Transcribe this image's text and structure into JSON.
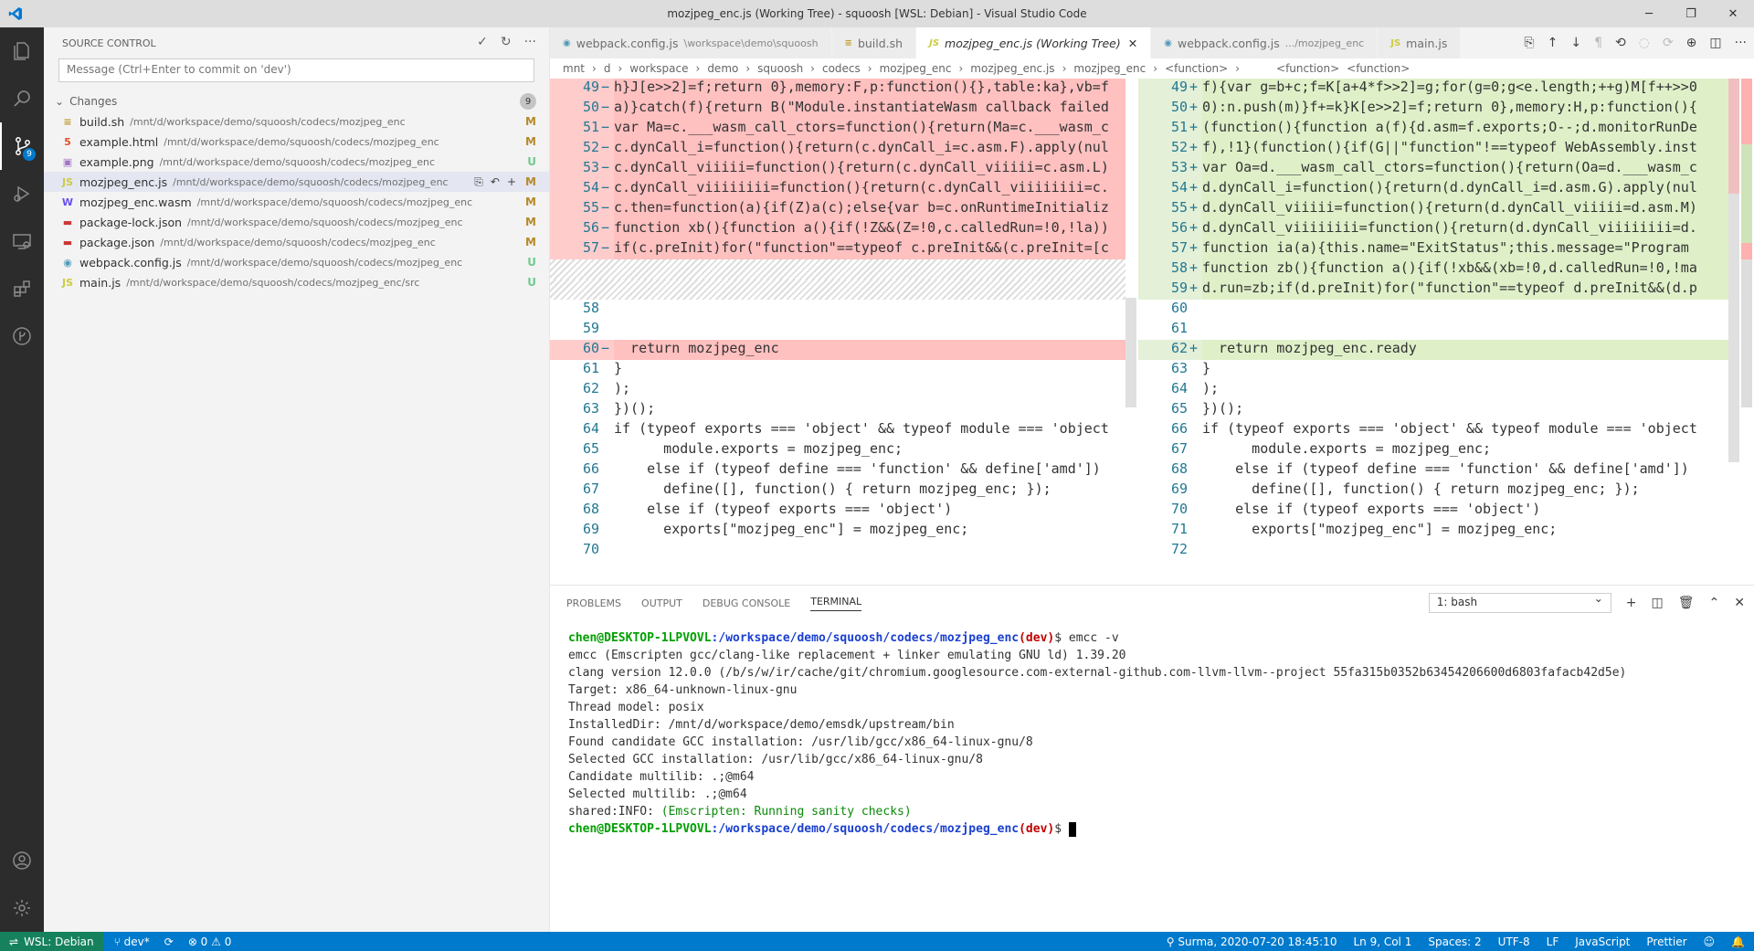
{
  "window": {
    "title": "mozjpeg_enc.js (Working Tree) - squoosh [WSL: Debian] - Visual Studio Code",
    "minimize": "─",
    "maximize": "❐",
    "close": "✕"
  },
  "sidebar": {
    "title": "SOURCE CONTROL",
    "commit_placeholder": "Message (Ctrl+Enter to commit on 'dev')",
    "changes_label": "Changes",
    "changes_count": "9",
    "files": [
      {
        "name": "build.sh",
        "path": "/mnt/d/workspace/demo/squoosh/codecs/mozjpeg_enc",
        "status": "M",
        "icon": "≡",
        "color": "#c09a2a"
      },
      {
        "name": "example.html",
        "path": "/mnt/d/workspace/demo/squoosh/codecs/mozjpeg_enc",
        "status": "M",
        "icon": "5",
        "color": "#e44d26"
      },
      {
        "name": "example.png",
        "path": "/mnt/d/workspace/demo/squoosh/codecs/mozjpeg_enc",
        "status": "U",
        "icon": "▣",
        "color": "#a074c4"
      },
      {
        "name": "mozjpeg_enc.js",
        "path": "/mnt/d/workspace/demo/squoosh/codecs/mozjpeg_enc",
        "status": "M",
        "icon": "JS",
        "color": "#cbcb41"
      },
      {
        "name": "mozjpeg_enc.wasm",
        "path": "/mnt/d/workspace/demo/squoosh/codecs/mozjpeg_enc",
        "status": "M",
        "icon": "W",
        "color": "#654ff0"
      },
      {
        "name": "package-lock.json",
        "path": "/mnt/d/workspace/demo/squoosh/codecs/mozjpeg_enc",
        "status": "M",
        "icon": "▬",
        "color": "#cb3837"
      },
      {
        "name": "package.json",
        "path": "/mnt/d/workspace/demo/squoosh/codecs/mozjpeg_enc",
        "status": "M",
        "icon": "▬",
        "color": "#cb3837"
      },
      {
        "name": "webpack.config.js",
        "path": "/mnt/d/workspace/demo/squoosh/codecs/mozjpeg_enc",
        "status": "U",
        "icon": "◉",
        "color": "#519aba"
      },
      {
        "name": "main.js",
        "path": "/mnt/d/workspace/demo/squoosh/codecs/mozjpeg_enc/src",
        "status": "U",
        "icon": "JS",
        "color": "#cbcb41"
      }
    ]
  },
  "tabs": [
    {
      "label": "webpack.config.js",
      "sub": "\\workspace\\demo\\squoosh",
      "icon": "◉"
    },
    {
      "label": "build.sh",
      "sub": "",
      "icon": "≡"
    },
    {
      "label": "mozjpeg_enc.js (Working Tree)",
      "sub": "",
      "icon": "JS"
    },
    {
      "label": "webpack.config.js",
      "sub": ".../mozjpeg_enc",
      "icon": "◉"
    },
    {
      "label": "main.js",
      "sub": "",
      "icon": "JS"
    }
  ],
  "breadcrumbs": [
    "mnt",
    "d",
    "workspace",
    "demo",
    "squoosh",
    "codecs",
    "mozjpeg_enc",
    "mozjpeg_enc.js",
    "mozjpeg_enc",
    "<function>"
  ],
  "breadcrumbs_right": [
    "<function>",
    "<function>"
  ],
  "diff": {
    "left": [
      {
        "n": "49",
        "t": "del",
        "code": "h}J[e>>2]=f;return 0},memory:F,p:function(){},table:ka},vb=f"
      },
      {
        "n": "50",
        "t": "del",
        "code": "a)}catch(f){return B(\"Module.instantiateWasm callback failed"
      },
      {
        "n": "51",
        "t": "del",
        "code": "var Ma=c.___wasm_call_ctors=function(){return(Ma=c.___wasm_c"
      },
      {
        "n": "52",
        "t": "del",
        "code": "c.dynCall_i=function(){return(c.dynCall_i=c.asm.F).apply(nul"
      },
      {
        "n": "53",
        "t": "del",
        "code": "c.dynCall_viiiii=function(){return(c.dynCall_viiiii=c.asm.L)"
      },
      {
        "n": "54",
        "t": "del",
        "code": "c.dynCall_viiiiiiii=function(){return(c.dynCall_viiiiiiii=c."
      },
      {
        "n": "55",
        "t": "del",
        "code": "c.then=function(a){if(Z)a(c);else{var b=c.onRuntimeInitializ"
      },
      {
        "n": "56",
        "t": "del",
        "code": "function xb(){function a(){if(!Z&&(Z=!0,c.calledRun=!0,!la))"
      },
      {
        "n": "57",
        "t": "del",
        "code": "if(c.preInit)for(\"function\"==typeof c.preInit&&(c.preInit=[c"
      },
      {
        "n": "",
        "t": "hatch",
        "code": ""
      },
      {
        "n": "",
        "t": "hatch",
        "code": ""
      },
      {
        "n": "58",
        "t": "",
        "code": ""
      },
      {
        "n": "59",
        "t": "",
        "code": ""
      },
      {
        "n": "60",
        "t": "del",
        "code": "  return mozjpeg_enc"
      },
      {
        "n": "61",
        "t": "",
        "code": "}"
      },
      {
        "n": "62",
        "t": "",
        "code": ");"
      },
      {
        "n": "63",
        "t": "",
        "code": "})();"
      },
      {
        "n": "64",
        "t": "",
        "code": "if (typeof exports === 'object' && typeof module === 'object"
      },
      {
        "n": "65",
        "t": "",
        "code": "      module.exports = mozjpeg_enc;"
      },
      {
        "n": "66",
        "t": "",
        "code": "    else if (typeof define === 'function' && define['amd'])"
      },
      {
        "n": "67",
        "t": "",
        "code": "      define([], function() { return mozjpeg_enc; });"
      },
      {
        "n": "68",
        "t": "",
        "code": "    else if (typeof exports === 'object')"
      },
      {
        "n": "69",
        "t": "",
        "code": "      exports[\"mozjpeg_enc\"] = mozjpeg_enc;"
      },
      {
        "n": "70",
        "t": "",
        "code": ""
      }
    ],
    "right": [
      {
        "n": "49",
        "t": "ins",
        "code": "f){var g=b+c;f=K[a+4*f>>2]=g;for(g=0;g<e.length;++g)M[f++>>0"
      },
      {
        "n": "50",
        "t": "ins",
        "code": "0):n.push(m)}f+=k}K[e>>2]=f;return 0},memory:H,p:function(){"
      },
      {
        "n": "51",
        "t": "ins",
        "code": "(function(){function a(f){d.asm=f.exports;O--;d.monitorRunDe"
      },
      {
        "n": "52",
        "t": "ins",
        "code": "f),!1}(function(){if(G||\"function\"!==typeof WebAssembly.inst"
      },
      {
        "n": "53",
        "t": "ins",
        "code": "var Oa=d.___wasm_call_ctors=function(){return(Oa=d.___wasm_c"
      },
      {
        "n": "54",
        "t": "ins",
        "code": "d.dynCall_i=function(){return(d.dynCall_i=d.asm.G).apply(nul"
      },
      {
        "n": "55",
        "t": "ins",
        "code": "d.dynCall_viiiii=function(){return(d.dynCall_viiiii=d.asm.M)"
      },
      {
        "n": "56",
        "t": "ins",
        "code": "d.dynCall_viiiiiiii=function(){return(d.dynCall_viiiiiiii=d."
      },
      {
        "n": "57",
        "t": "ins",
        "code": "function ia(a){this.name=\"ExitStatus\";this.message=\"Program "
      },
      {
        "n": "58",
        "t": "ins",
        "code": "function zb(){function a(){if(!xb&&(xb=!0,d.calledRun=!0,!ma"
      },
      {
        "n": "59",
        "t": "ins",
        "code": "d.run=zb;if(d.preInit)for(\"function\"==typeof d.preInit&&(d.p"
      },
      {
        "n": "60",
        "t": "",
        "code": ""
      },
      {
        "n": "61",
        "t": "",
        "code": ""
      },
      {
        "n": "62",
        "t": "ins",
        "code": "  return mozjpeg_enc.ready"
      },
      {
        "n": "63",
        "t": "",
        "code": "}"
      },
      {
        "n": "64",
        "t": "",
        "code": ");"
      },
      {
        "n": "65",
        "t": "",
        "code": "})();"
      },
      {
        "n": "66",
        "t": "",
        "code": "if (typeof exports === 'object' && typeof module === 'object"
      },
      {
        "n": "67",
        "t": "",
        "code": "      module.exports = mozjpeg_enc;"
      },
      {
        "n": "68",
        "t": "",
        "code": "    else if (typeof define === 'function' && define['amd'])"
      },
      {
        "n": "69",
        "t": "",
        "code": "      define([], function() { return mozjpeg_enc; });"
      },
      {
        "n": "70",
        "t": "",
        "code": "    else if (typeof exports === 'object')"
      },
      {
        "n": "71",
        "t": "",
        "code": "      exports[\"mozjpeg_enc\"] = mozjpeg_enc;"
      },
      {
        "n": "72",
        "t": "",
        "code": ""
      }
    ]
  },
  "panel": {
    "tabs": [
      "PROBLEMS",
      "OUTPUT",
      "DEBUG CONSOLE",
      "TERMINAL"
    ],
    "terminal_select": "1: bash",
    "prompt_user": "chen@DESKTOP-1LPVOVL",
    "prompt_path": ":/workspace/demo/squoosh/codecs/mozjpeg_enc",
    "prompt_branch": "(dev)",
    "command": "$ emcc -v",
    "output": [
      "emcc (Emscripten gcc/clang-like replacement + linker emulating GNU ld) 1.39.20",
      "clang version 12.0.0 (/b/s/w/ir/cache/git/chromium.googlesource.com-external-github.com-llvm-llvm--project 55fa315b0352b63454206600d6803fafacb42d5e)",
      "Target: x86_64-unknown-linux-gnu",
      "Thread model: posix",
      "InstalledDir: /mnt/d/workspace/demo/emsdk/upstream/bin",
      "Found candidate GCC installation: /usr/lib/gcc/x86_64-linux-gnu/8",
      "Selected GCC installation: /usr/lib/gcc/x86_64-linux-gnu/8",
      "Candidate multilib: .;@m64",
      "Selected multilib: .;@m64"
    ],
    "info_prefix": "shared:INFO: ",
    "info_text": "(Emscripten: Running sanity checks)",
    "prompt_end": "$ "
  },
  "status": {
    "remote": "WSL: Debian",
    "branch": "dev*",
    "sync": "⟳",
    "problems": "⊗ 0 ⚠ 0",
    "blame": "Surma, 2020-07-20 18:45:10",
    "position": "Ln 9, Col 1",
    "spaces": "Spaces: 2",
    "encoding": "UTF-8",
    "eol": "LF",
    "language": "JavaScript",
    "formatter": "Prettier"
  },
  "colors": {
    "accent": "#007acc",
    "deleted": "#ffcccc",
    "inserted": "#e4f0d8",
    "remote": "#16825d"
  }
}
